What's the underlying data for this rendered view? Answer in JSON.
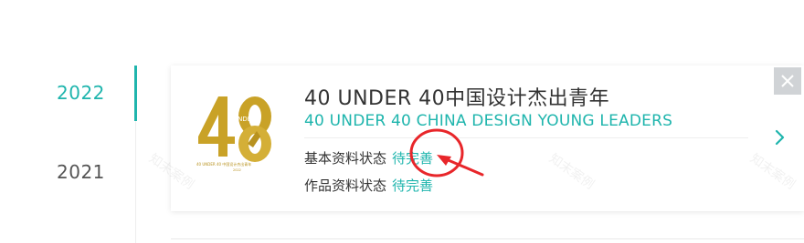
{
  "years": [
    {
      "label": "2022",
      "active": true
    },
    {
      "label": "2021",
      "active": false
    }
  ],
  "card": {
    "title_cn": "40 UNDER 40中国设计杰出青年",
    "title_en": "40 UNDER 40 CHINA DESIGN YOUNG LEADERS",
    "logo": {
      "top_text": "UNDER",
      "bottom_text": "40 UNDER 40 中国设计杰出青年",
      "small_text": "2022"
    },
    "status_rows": [
      {
        "label": "基本资料状态",
        "value": "待完善"
      },
      {
        "label": "作品资料状态",
        "value": "待完善"
      }
    ]
  },
  "watermarks": [
    "知末案例",
    "知末案例",
    "知末案例"
  ],
  "colors": {
    "accent": "#1fb5ad",
    "annotation": "#e8262a",
    "gold": "#c9a227",
    "close_bg": "#d0d3d6"
  },
  "icons": {
    "next": "chevron-right-icon",
    "close": "close-icon"
  }
}
